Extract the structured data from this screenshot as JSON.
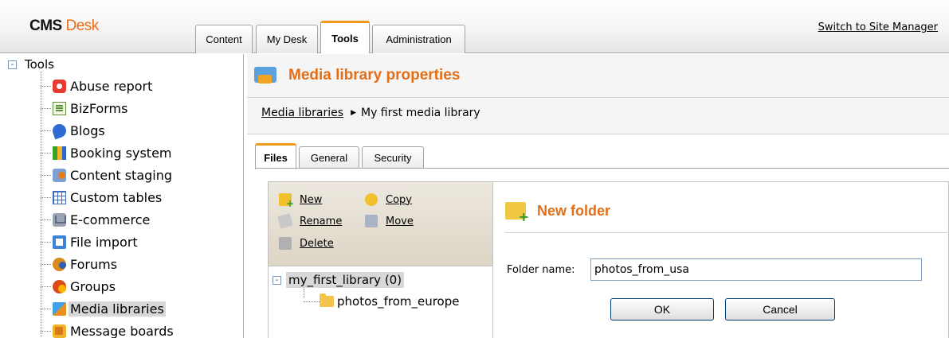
{
  "header": {
    "logo_part1": "CMS",
    "logo_part2": "Desk",
    "tabs": [
      {
        "label": "Content"
      },
      {
        "label": "My Desk"
      },
      {
        "label": "Tools"
      },
      {
        "label": "Administration"
      }
    ],
    "switch_link": "Switch to Site Manager"
  },
  "tree": {
    "root_label": "Tools",
    "root_toggle": "-",
    "items": [
      {
        "label": "Abuse report",
        "icon": "abuse-report-icon"
      },
      {
        "label": "BizForms",
        "icon": "bizforms-icon"
      },
      {
        "label": "Blogs",
        "icon": "blogs-icon"
      },
      {
        "label": "Booking system",
        "icon": "booking-system-icon"
      },
      {
        "label": "Content staging",
        "icon": "content-staging-icon"
      },
      {
        "label": "Custom tables",
        "icon": "custom-tables-icon"
      },
      {
        "label": "E-commerce",
        "icon": "ecommerce-icon"
      },
      {
        "label": "File import",
        "icon": "file-import-icon"
      },
      {
        "label": "Forums",
        "icon": "forums-icon"
      },
      {
        "label": "Groups",
        "icon": "groups-icon"
      },
      {
        "label": "Media libraries",
        "icon": "media-libraries-icon",
        "selected": true
      },
      {
        "label": "Message boards",
        "icon": "message-boards-icon"
      }
    ]
  },
  "page": {
    "title": "Media library properties",
    "breadcrumb_link": "Media libraries",
    "breadcrumb_current": "My first media library",
    "subtabs": [
      {
        "label": "Files"
      },
      {
        "label": "General"
      },
      {
        "label": "Security"
      }
    ]
  },
  "actions": {
    "new": "New",
    "copy": "Copy",
    "rename": "Rename",
    "move": "Move",
    "delete": "Delete"
  },
  "library_tree": {
    "root_toggle": "-",
    "root": "my_first_library (0)",
    "child": "photos_from_europe"
  },
  "new_folder": {
    "title": "New folder",
    "field_label": "Folder name:",
    "field_value": "photos_from_usa",
    "ok": "OK",
    "cancel": "Cancel"
  }
}
